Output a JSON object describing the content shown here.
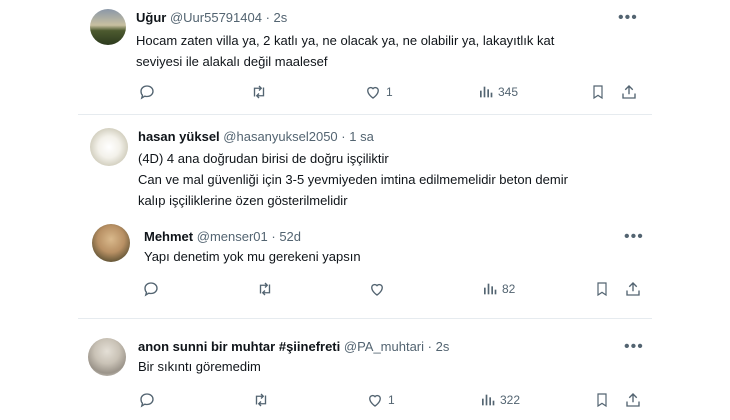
{
  "tweets": [
    {
      "name": "Uğur",
      "handle": "@Uur55791404",
      "time": "· 2s",
      "lines": [
        "Hocam zaten villa ya, 2 katlı ya, ne olacak ya, ne olabilir ya, lakayıtlık kat",
        "seviyesi ile alakalı değil maalesef"
      ],
      "likes": "1",
      "views": "345"
    },
    {
      "name": "hasan yüksel",
      "handle": "@hasanyuksel2050",
      "time": "· 1 sa",
      "lines": [
        "(4D) 4 ana doğrudan birisi de doğru işçiliktir",
        "Can ve mal güvenliği için 3-5 yevmiyeden imtina edilmemelidir beton demir",
        "kalıp işçiliklerine özen gösterilmelidir"
      ]
    },
    {
      "name": "Mehmet",
      "handle": "@menser01",
      "time": "· 52d",
      "lines": [
        "Yapı denetim yok mu gerekeni yapsın"
      ],
      "likes": "",
      "views": "82"
    },
    {
      "name": "anon sunni bir muhtar #şiinefreti",
      "handle": "@PA_muhtari",
      "time": "· 2s",
      "lines": [
        "Bir sıkıntı göremedim"
      ],
      "likes": "1",
      "views": "322"
    }
  ],
  "icons": {
    "more": "more-dots-icon",
    "reply": "reply-icon",
    "retweet": "retweet-icon",
    "like": "heart-icon",
    "views": "views-bar-chart-icon",
    "bookmark": "bookmark-icon",
    "share": "share-icon"
  },
  "colors": {
    "text": "#0f1419",
    "muted": "#536471",
    "divider": "#e6ebef"
  }
}
